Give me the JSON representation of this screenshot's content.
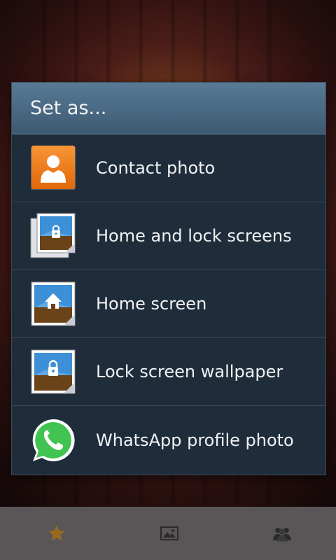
{
  "dialog": {
    "title": "Set as...",
    "options": [
      {
        "label": "Contact photo",
        "icon": "contact-photo-icon"
      },
      {
        "label": "Home and lock screens",
        "icon": "home-lock-screens-icon"
      },
      {
        "label": "Home screen",
        "icon": "home-screen-icon"
      },
      {
        "label": "Lock screen wallpaper",
        "icon": "lock-screen-icon"
      },
      {
        "label": "WhatsApp profile photo",
        "icon": "whatsapp-icon"
      }
    ]
  },
  "bottom_bar": {
    "items": [
      {
        "icon": "star-icon"
      },
      {
        "icon": "gallery-icon"
      },
      {
        "icon": "people-icon"
      }
    ]
  },
  "colors": {
    "dialog_bg": "#1f2d3a",
    "header_bg": "#4a6a84",
    "contact_orange": "#f07a10",
    "whatsapp_green": "#40c351"
  }
}
